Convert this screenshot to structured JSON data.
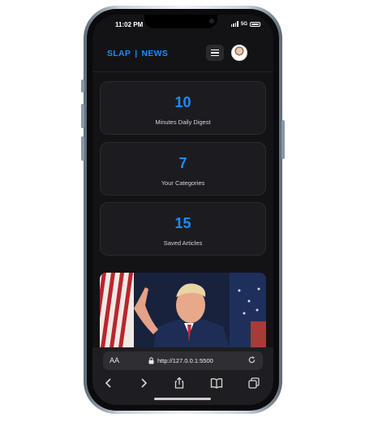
{
  "status_bar": {
    "time": "11:02 PM",
    "network": "5G"
  },
  "header": {
    "brand_left": "SLAP",
    "brand_sep": "|",
    "brand_right": "NEWS"
  },
  "stats": [
    {
      "value": "10",
      "label": "Minutes Daily Digest"
    },
    {
      "value": "7",
      "label": "Your Categories"
    },
    {
      "value": "15",
      "label": "Saved Articles"
    }
  ],
  "browser": {
    "text_size_label": "AA",
    "url": "http://127.0.0.1:5500"
  },
  "colors": {
    "accent": "#1a8cff",
    "card_bg": "#1c1c20",
    "screen_bg": "#131316",
    "browser_bar": "#1e1e22"
  }
}
